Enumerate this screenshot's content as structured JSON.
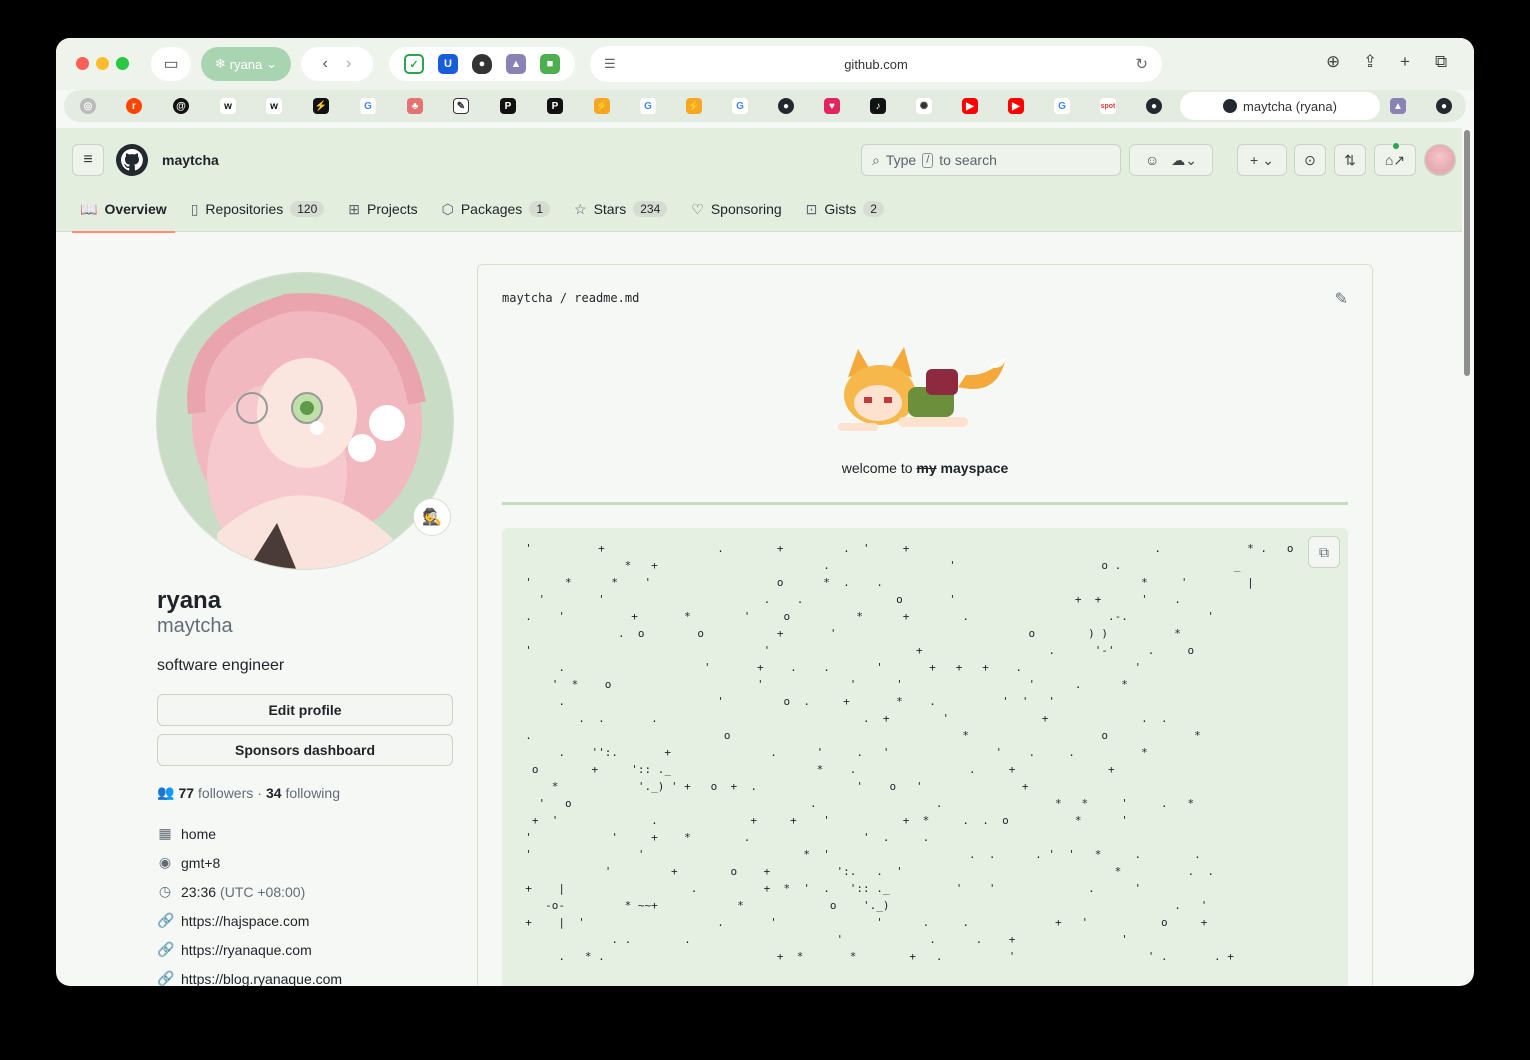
{
  "browser": {
    "profile_label": "ryana",
    "url": "github.com",
    "active_tab_title": "maytcha (ryana)"
  },
  "header": {
    "username": "maytcha",
    "search_placeholder_pre": "Type",
    "search_key": "/",
    "search_placeholder_post": "to search",
    "plus_label": "+"
  },
  "nav": [
    {
      "label": "Overview",
      "icon": "book-icon"
    },
    {
      "label": "Repositories",
      "count": "120",
      "icon": "repo-icon"
    },
    {
      "label": "Projects",
      "icon": "table-icon"
    },
    {
      "label": "Packages",
      "count": "1",
      "icon": "package-icon"
    },
    {
      "label": "Stars",
      "count": "234",
      "icon": "star-icon"
    },
    {
      "label": "Sponsoring",
      "icon": "heart-icon"
    },
    {
      "label": "Gists",
      "count": "2",
      "icon": "code-square-icon"
    }
  ],
  "profile": {
    "name": "ryana",
    "login": "maytcha",
    "bio": "software engineer",
    "edit_button": "Edit profile",
    "sponsors_button": "Sponsors dashboard",
    "followers_count": "77",
    "followers_label": "followers",
    "separator": "·",
    "following_count": "34",
    "following_label": "following",
    "company": "home",
    "location": "gmt+8",
    "local_time": "23:36",
    "timezone": "(UTC +08:00)",
    "links": [
      "https://hajspace.com",
      "https://ryanaque.com",
      "https://blog.ryanaque.com"
    ]
  },
  "readme": {
    "owner": "maytcha",
    "slash": "/",
    "file": "readme.md",
    "welcome_pre": "welcome to",
    "welcome_strike": "my",
    "welcome_bold": "mayspace",
    "ascii": "  '          +                 .        +         .  '     +                                     .             * .   o\n                 *   +                         .                  '                      o .                 _ \n  '     *      *    '                   o      *  .    .                                       *     '         |\n    '        '                        .    .              o       '                  +  +      '    .\n  .    '          +       *        '     o          *      +        .                     .-.            '\n                .  o        o           +       '                             o        ) )          *\n  '                                   '                      +                   .      '-'     .     o\n       .                     '       +    .    .       '       +   +   +    .                 '\n      '  *    o                      '             '      '                   '      .      *\n       .                       '         o  .     +       *    .          '  '   '\n          .  .       .                               .  +        '              +              .  .\n  .                             o                                   *                    o             *\n       .    '':.       +               .      '     .   '                '    .     .          *\n   o        +     ':: ._                      *    .                 .     +              +\n      *            '._) ' +   o  +  .               '    o   '               +\n    '   o                                    .                  .                 *   *     '     .   *\n   +  '              .              +     +    '           +  *     .  .  o          *      '\n  '            '     +    *        .                 '  .     .\n  '                '                        *  '                     .  .      . '  '   *     .        .\n              '         +        o    +          ':.   .  '                                *          .  .\n  +    |                   .          +  *  '  .   ':: ._          '    '              .      '\n     -o-         * ~~+            *             o    '._)                                           .   '\n  +    |  '                    .       '               '      .     .             +   '           o     +\n               . .        .                      '             .      .    +                '\n       .   * .                          +  *       *        +   .          '                    ' .       . +"
  }
}
